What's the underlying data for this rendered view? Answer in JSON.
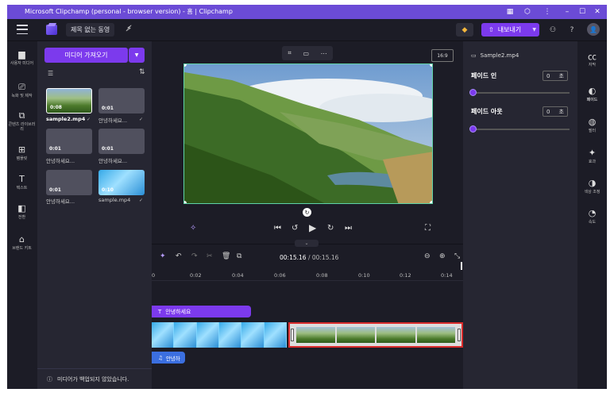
{
  "window": {
    "title": "Microsoft Clipchamp (personal - browser version) - 홈 | Clipchamp",
    "controls": [
      "minimize",
      "maximize",
      "close"
    ]
  },
  "topbar": {
    "project_title": "제목 없는 동영",
    "export_label": "내보내기"
  },
  "left_nav": [
    {
      "label": "사용자 미디어",
      "icon": "folder-icon"
    },
    {
      "label": "녹화 및 제작",
      "icon": "camera-icon"
    },
    {
      "label": "콘텐츠 라이브러리",
      "icon": "library-icon"
    },
    {
      "label": "템플릿",
      "icon": "grid-icon"
    },
    {
      "label": "텍스트",
      "icon": "text-icon"
    },
    {
      "label": "전환",
      "icon": "transition-icon"
    },
    {
      "label": "브랜드 키트",
      "icon": "brand-icon"
    }
  ],
  "media_panel": {
    "import_label": "미디어 가져오기",
    "items": [
      {
        "duration": "0:08",
        "caption": "sample2.mp4",
        "thumb": "forest",
        "selected": true
      },
      {
        "duration": "0:01",
        "caption": "안녕하세요...",
        "thumb": "gray"
      },
      {
        "duration": "0:01",
        "caption": "안녕하세요...",
        "thumb": "gray"
      },
      {
        "duration": "0:01",
        "caption": "안녕하세요...",
        "thumb": "gray"
      },
      {
        "duration": "0:01",
        "caption": "안녕하세요...",
        "thumb": "gray"
      },
      {
        "duration": "0:10",
        "caption": "sample.mp4",
        "thumb": "water"
      }
    ],
    "backup_notice": "미디어가 백업되지 않았습니다."
  },
  "stage": {
    "aspect_ratio": "16:9"
  },
  "timeline": {
    "current_time": "00:15.16",
    "total_time": "00:15.16",
    "ticks": [
      "0",
      "0:02",
      "0:04",
      "0:06",
      "0:08",
      "0:10",
      "0:12",
      "0:14"
    ],
    "text_clip_label": "안녕하세요",
    "audio_clip_label": "안녕하"
  },
  "right_panel": {
    "clip_name": "Sample2.mp4",
    "fade_in_label": "페이드 인",
    "fade_in_value": "0",
    "fade_out_label": "페이드 아웃",
    "fade_out_value": "0",
    "unit": "초"
  },
  "right_nav": [
    {
      "label": "자막",
      "icon": "captions-icon"
    },
    {
      "label": "페이드",
      "icon": "fade-icon"
    },
    {
      "label": "필터",
      "icon": "filter-icon"
    },
    {
      "label": "효과",
      "icon": "effects-icon"
    },
    {
      "label": "색상 조정",
      "icon": "color-icon"
    },
    {
      "label": "속도",
      "icon": "speed-icon"
    }
  ],
  "colors": {
    "accent": "#7c3aed",
    "titlebar": "#6b4bd6",
    "selection": "#d92b2b"
  }
}
